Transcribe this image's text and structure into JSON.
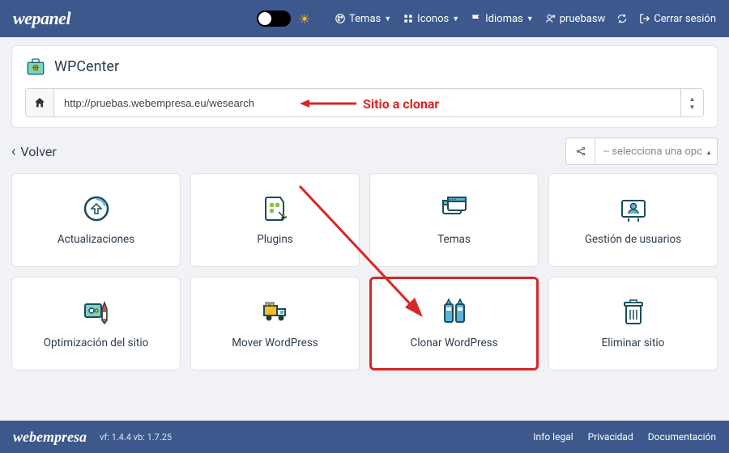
{
  "topbar": {
    "brand": "wepanel",
    "nav": {
      "themes": "Temas",
      "icons": "Iconos",
      "languages": "Idiomas",
      "user": "pruebasw",
      "logout": "Cerrar sesión"
    }
  },
  "panel": {
    "title": "WPCenter",
    "url": "http://pruebas.webempresa.eu/wesearch"
  },
  "annotations": {
    "site_to_clone": "Sitio a clonar"
  },
  "back": {
    "label": "Volver"
  },
  "selector": {
    "placeholder": "-- selecciona una opc"
  },
  "cards": [
    {
      "label": "Actualizaciones"
    },
    {
      "label": "Plugins"
    },
    {
      "label": "Temas"
    },
    {
      "label": "Gestión de usuarios"
    },
    {
      "label": "Optimización del sitio"
    },
    {
      "label": "Mover WordPress"
    },
    {
      "label": "Clonar WordPress"
    },
    {
      "label": "Eliminar sitio"
    }
  ],
  "footer": {
    "brand": "webempresa",
    "versions": "vf: 1.4.4 vb: 1.7.25",
    "links": {
      "legal": "Info legal",
      "privacy": "Privacidad",
      "docs": "Documentación"
    }
  }
}
